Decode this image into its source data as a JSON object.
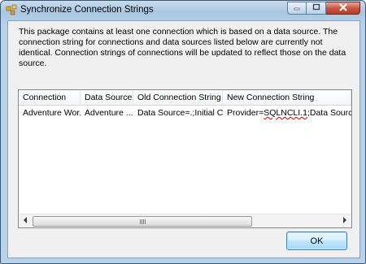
{
  "window": {
    "title": "Synchronize Connection Strings",
    "icons": {
      "app": "ssis-package-icon",
      "minimize": "minimize-icon",
      "maximize": "maximize-icon",
      "close": "close-icon"
    }
  },
  "message": "This package contains at least one connection which is based on a data source. The connection string for connections and data sources listed below are currently not identical. Connection strings of connections will be updated to reflect those on the data source.",
  "list": {
    "columns": [
      "Connection",
      "Data Source",
      "Old Connection String",
      "New Connection String"
    ],
    "rows": [
      {
        "connection": "Adventure Wor...",
        "data_source": "Adventure ...",
        "old_string": "Data Source=.;Initial Ca...",
        "new_prefix": "Provider=",
        "new_highlight": "SQLNCLI.1",
        "new_suffix": ";Data Source=.;"
      }
    ]
  },
  "buttons": {
    "ok": "OK"
  },
  "colors": {
    "highlight_underline": "#d00000",
    "ok_border": "#3c7fb1"
  }
}
